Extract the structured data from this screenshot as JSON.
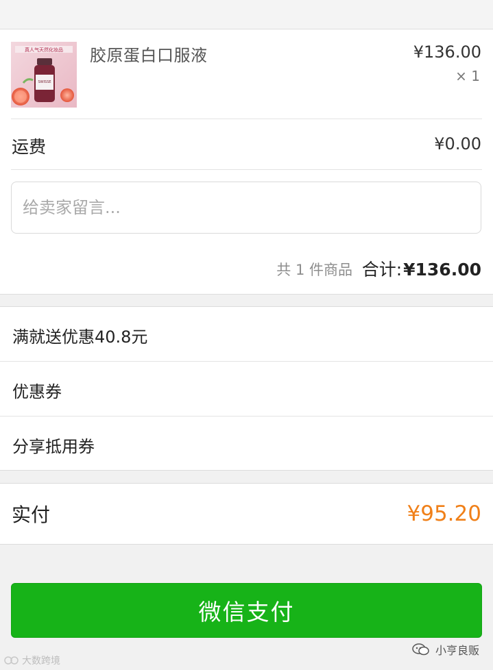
{
  "product": {
    "name": "胶原蛋白口服液",
    "price": "¥136.00",
    "quantity": "× 1",
    "image_caption": "真人气天然化妆品",
    "image_badge": "SWISSE"
  },
  "shipping": {
    "label": "运费",
    "value": "¥0.00"
  },
  "message": {
    "placeholder": "给卖家留言..."
  },
  "summary": {
    "item_count": "共 1 件商品",
    "total_label": "合计:",
    "total_value": "¥136.00"
  },
  "promotions": [
    {
      "label": "满就送优惠40.8元"
    },
    {
      "label": "优惠券"
    },
    {
      "label": "分享抵用券"
    }
  ],
  "payment": {
    "paid_label": "实付",
    "paid_value": "¥95.20",
    "pay_button_label": "微信支付"
  },
  "watermarks": {
    "left": "大数跨境",
    "right": "小亨良贩"
  },
  "colors": {
    "accent_green": "#17b318",
    "price_orange": "#f08019"
  }
}
